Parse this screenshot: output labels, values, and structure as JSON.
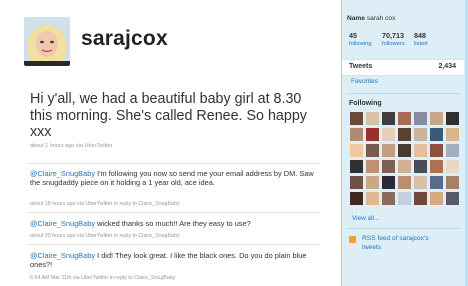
{
  "profile": {
    "username": "sarajcox",
    "name_label": "Name",
    "name_value": "sarah cox"
  },
  "stats": [
    {
      "value": "45",
      "label": "following"
    },
    {
      "value": "70,713",
      "label": "followers"
    },
    {
      "value": "848",
      "label": "listed"
    }
  ],
  "sidebar": {
    "tweets_label": "Tweets",
    "tweets_count": "2,434",
    "favorites_label": "Favorites",
    "following_heading": "Following",
    "view_all": "View all...",
    "rss_line1": "RSS feed of sarajcox's",
    "rss_line2": "tweets"
  },
  "latest_tweet": {
    "text": "Hi y'all, we had a beautiful baby girl at 8.30 this morning. She's called Renee. So happy xxx",
    "meta": "about 1 hours ago via UberTwitter"
  },
  "tweets": [
    {
      "mention": "@Claire_SnugBaby",
      "text": " I'm following you now so send me your email address by DM. Saw the snugdaddy piece on it holding a 1 year old, ace idea.",
      "meta": "about 19 hours ago via UberTwitter in reply to Claire_SnugBaby"
    },
    {
      "mention": "@Claire_SnugBaby",
      "text": " wicked thanks so much!! Are they easy to use?",
      "meta": "about 20 hours ago via UberTwitter in reply to Claire_SnugBaby"
    },
    {
      "mention": "@Claire_SnugBaby",
      "text": " I did! They look great. I like the black ones. Do you do plain blue ones?!",
      "meta": "6:54 AM Mar 11th via UberTwitter in reply to Claire_SnugBaby"
    }
  ],
  "following_avatar_colors": [
    "#6b4a3a",
    "#d7c2a8",
    "#3e3e3e",
    "#a86b55",
    "#8a8aa0",
    "#c9a68a",
    "#2f2f2f",
    "#b08a6e",
    "#9b2f2f",
    "#e4d0b8",
    "#5a4030",
    "#c8b4a0",
    "#3a5a7a",
    "#d9b48c",
    "#f0c8a0",
    "#7a5a4a",
    "#c0a080",
    "#4a3a30",
    "#e0c0a0",
    "#905040",
    "#a0b0c0",
    "#303030",
    "#c09070",
    "#806050",
    "#d0b090",
    "#4a4a5a",
    "#b07050",
    "#e8d8c8",
    "#705040",
    "#c8a888",
    "#2a2a3a",
    "#b89070",
    "#d8c0a8",
    "#5a6a8a",
    "#a88068",
    "#402820",
    "#e0b890",
    "#8a6a5a",
    "#c0d0e0",
    "#704838",
    "#d8a880",
    "#585868"
  ]
}
